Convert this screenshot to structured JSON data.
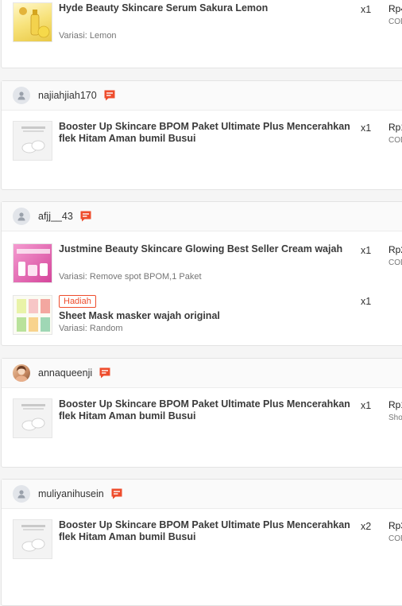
{
  "orders": [
    {
      "items": [
        {
          "title": "Hyde Beauty Skincare Serum Sakura Lemon",
          "variant": "Variasi: Lemon",
          "qty": "x1",
          "price": "Rp4",
          "payment": "COD"
        }
      ]
    },
    {
      "username": "najiahjiah170",
      "items": [
        {
          "title": "Booster Up Skincare BPOM Paket Ultimate Plus Mencerahkan flek Hitam Aman bumil Busui",
          "qty": "x1",
          "price": "Rp1",
          "payment": "COD"
        }
      ]
    },
    {
      "username": "afjj__43",
      "items": [
        {
          "title": "Justmine Beauty Skincare Glowing Best Seller Cream wajah",
          "variant": "Variasi: Remove spot BPOM,1 Paket",
          "qty": "x1",
          "price": "Rp2",
          "payment": "COD"
        },
        {
          "badge": "Hadiah",
          "title": "Sheet Mask masker wajah original",
          "variant": "Variasi: Random",
          "qty": "x1"
        }
      ]
    },
    {
      "username": "annaqueenji",
      "items": [
        {
          "title": "Booster Up Skincare BPOM Paket Ultimate Plus Mencerahkan flek Hitam Aman bumil Busui",
          "qty": "x1",
          "price": "Rp1",
          "payment": "Sho"
        }
      ]
    },
    {
      "username": "muliyanihusein",
      "items": [
        {
          "title": "Booster Up Skincare BPOM Paket Ultimate Plus Mencerahkan flek Hitam Aman bumil Busui",
          "qty": "x2",
          "price": "Rp3",
          "payment": "COD"
        }
      ]
    }
  ],
  "icons": {
    "chat": "chat-icon",
    "avatar": "user-avatar-icon"
  },
  "colors": {
    "accent": "#ee4d2d",
    "card_header": "#fafafa"
  }
}
